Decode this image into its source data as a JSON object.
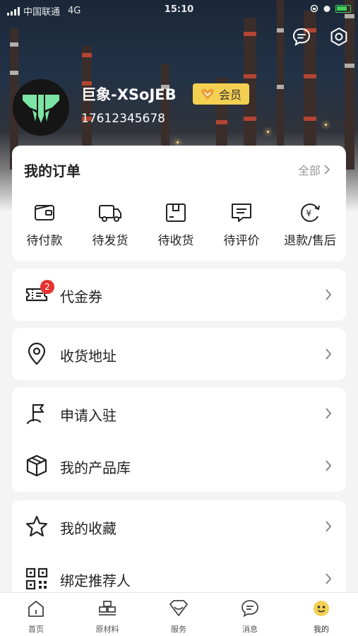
{
  "status_bar": {
    "carrier": "中国联通",
    "network": "4G",
    "time": "15:10"
  },
  "profile": {
    "username": "巨象-XSoJEB",
    "vip_label": "会员",
    "phone": "17612345678"
  },
  "orders": {
    "title": "我的订单",
    "all_label": "全部",
    "items": [
      {
        "label": "待付款",
        "icon": "wallet-icon"
      },
      {
        "label": "待发货",
        "icon": "truck-icon"
      },
      {
        "label": "待收货",
        "icon": "package-icon"
      },
      {
        "label": "待评价",
        "icon": "comment-icon"
      },
      {
        "label": "退款/售后",
        "icon": "refund-icon"
      }
    ]
  },
  "menu": {
    "coupon": {
      "label": "代金券",
      "badge": "2",
      "icon": "ticket-icon"
    },
    "address": {
      "label": "收货地址",
      "icon": "location-icon"
    },
    "apply": {
      "label": "申请入驻",
      "icon": "flag-icon"
    },
    "products": {
      "label": "我的产品库",
      "icon": "box-icon"
    },
    "favorites": {
      "label": "我的收藏",
      "icon": "star-icon"
    },
    "referrer": {
      "label": "绑定推荐人",
      "icon": "qrcode-icon"
    }
  },
  "tabbar": {
    "items": [
      {
        "label": "首页",
        "icon": "home-icon"
      },
      {
        "label": "原材料",
        "icon": "materials-icon"
      },
      {
        "label": "服务",
        "icon": "service-icon"
      },
      {
        "label": "消息",
        "icon": "message-icon"
      },
      {
        "label": "我的",
        "icon": "profile-icon",
        "active": true
      }
    ]
  },
  "colors": {
    "accent": "#f3cf52",
    "badge": "#e6322f",
    "battery": "#3fd15a"
  }
}
